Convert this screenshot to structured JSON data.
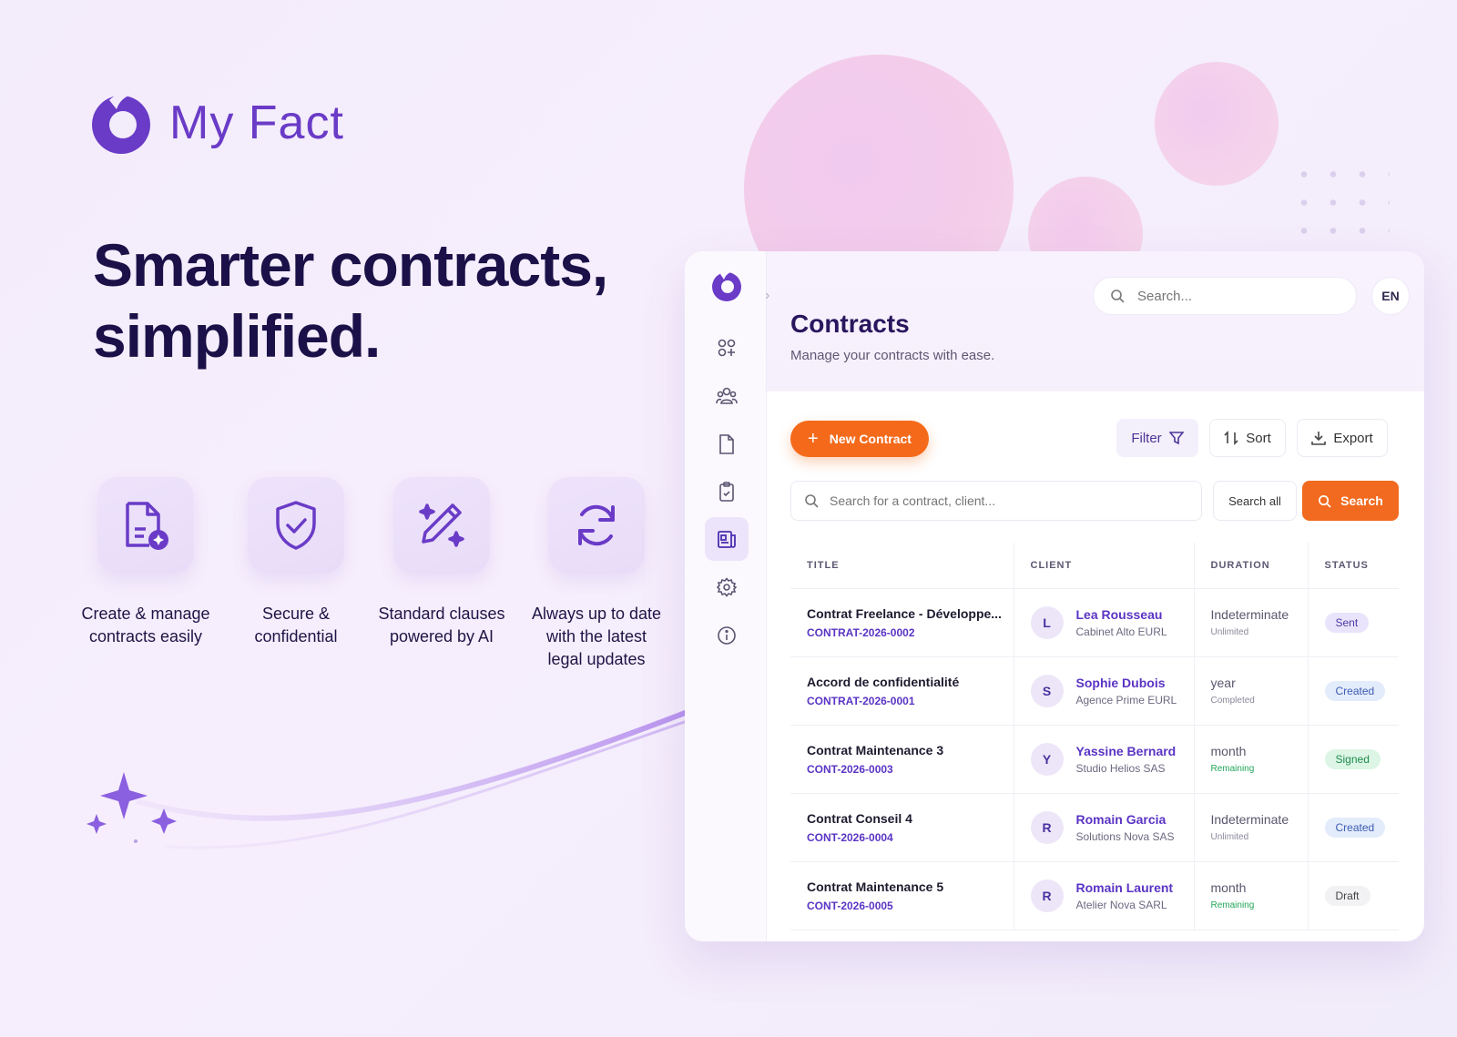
{
  "brand": {
    "name": "My Fact"
  },
  "hero": {
    "line1": "Smarter contracts,",
    "line2": "simplified."
  },
  "features": [
    {
      "icon": "document-add-icon",
      "label_lines": [
        "Create & manage",
        "contracts easily"
      ]
    },
    {
      "icon": "shield-check-icon",
      "label_lines": [
        "Secure &",
        "confidential"
      ]
    },
    {
      "icon": "pen-sparkle-icon",
      "label_lines": [
        "Standard clauses",
        "powered by AI"
      ]
    },
    {
      "icon": "refresh-icon",
      "label_lines": [
        "Always up to date",
        "with the latest",
        "legal updates"
      ]
    }
  ],
  "app": {
    "top_search_placeholder": "Search...",
    "lang": "EN",
    "title": "Contracts",
    "subtitle": "Manage your contracts with ease.",
    "toolbar": {
      "new_contract": "New Contract",
      "filter": "Filter",
      "sort": "Sort",
      "export": "Export"
    },
    "search": {
      "placeholder": "Search for a contract, client...",
      "search_all": "Search all",
      "search_button": "Search"
    },
    "sidebar": [
      "dashboard-icon",
      "users-icon",
      "document-icon",
      "clipboard-icon",
      "contracts-icon",
      "settings-icon",
      "info-icon"
    ],
    "table": {
      "headers": [
        "TITLE",
        "CLIENT",
        "DURATION",
        "STATUS"
      ],
      "rows": [
        {
          "title": "Contrat Freelance - Développe...",
          "ref": "CONTRAT-2026-0002",
          "initial": "L",
          "client": "Lea Rousseau",
          "company": "Cabinet Alto EURL",
          "duration": "Indeterminate",
          "duration_sub": "Unlimited",
          "status": "Sent"
        },
        {
          "title": "Accord de confidentialité",
          "ref": "CONTRAT-2026-0001",
          "initial": "S",
          "client": "Sophie Dubois",
          "company": "Agence Prime EURL",
          "duration": "year",
          "duration_sub": "Completed",
          "status": "Created"
        },
        {
          "title": "Contrat Maintenance 3",
          "ref": "CONT-2026-0003",
          "initial": "Y",
          "client": "Yassine Bernard",
          "company": "Studio Helios SAS",
          "duration": "month",
          "duration_sub": "Remaining",
          "status": "Signed"
        },
        {
          "title": "Contrat Conseil 4",
          "ref": "CONT-2026-0004",
          "initial": "R",
          "client": "Romain Garcia",
          "company": "Solutions Nova SAS",
          "duration": "Indeterminate",
          "duration_sub": "Unlimited",
          "status": "Created"
        },
        {
          "title": "Contrat Maintenance 5",
          "ref": "CONT-2026-0005",
          "initial": "R",
          "client": "Romain Laurent",
          "company": "Atelier Nova SARL",
          "duration": "month",
          "duration_sub": "Remaining",
          "status": "Draft"
        }
      ]
    }
  }
}
